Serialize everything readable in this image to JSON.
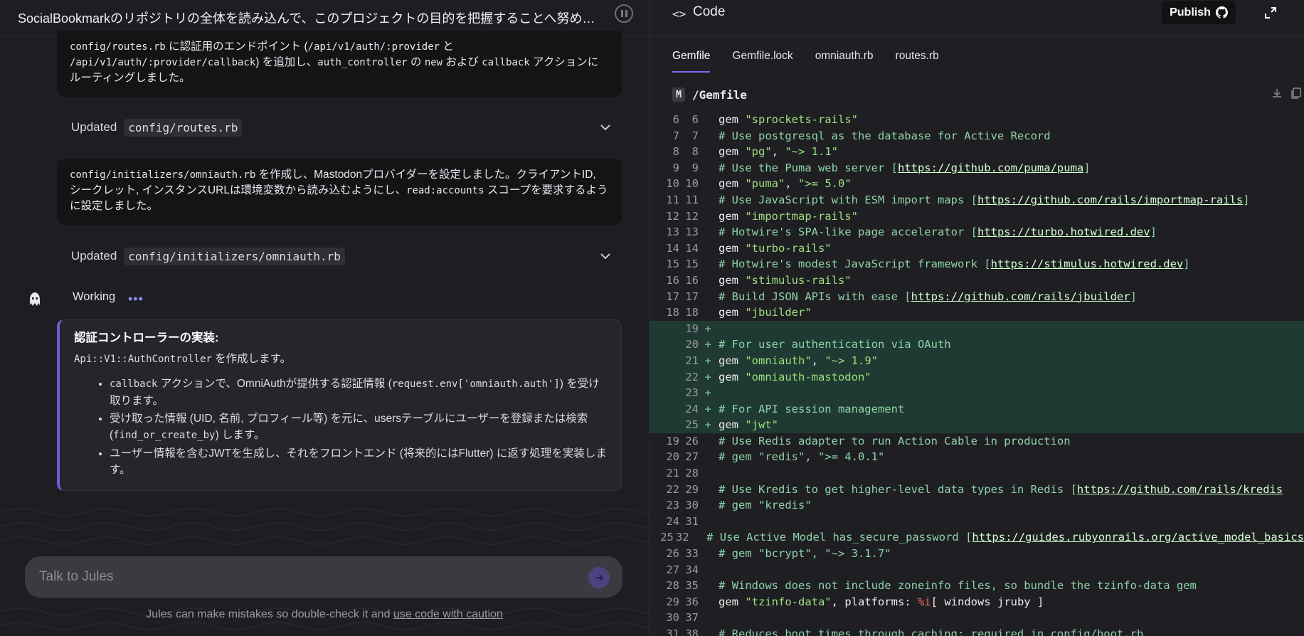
{
  "task": {
    "title": "SocialBookmarkのリポジトリの全体を読み込んで、このプロジェクトの目的を把握することへ努めて下..."
  },
  "messages": {
    "card1": {
      "text_a": "config/routes.rb",
      "text_b": " に認証用のエンドポイント (",
      "text_c": "/api/v1/auth/:provider",
      "text_d": " と",
      "text_e": "/api/v1/auth/:provider/callback",
      "text_f": ") を追加し、",
      "text_g": "auth_controller",
      "text_h": " の ",
      "text_i": "new",
      "text_j": " および ",
      "text_k": "callback",
      "text_l": " アクションにルーティングしました。"
    },
    "updated1": {
      "label": "Updated",
      "file": "config/routes.rb"
    },
    "card2": {
      "text_a": "config/initializers/omniauth.rb",
      "text_b": " を作成し、Mastodonプロバイダーを設定しました。クライアントID, シークレット, インスタンスURLは環境変数から読み込むようにし、",
      "text_c": "read:accounts",
      "text_d": " スコープを要求するように設定しました。"
    },
    "updated2": {
      "label": "Updated",
      "file": "config/initializers/omniauth.rb"
    },
    "working": {
      "label": "Working",
      "dots": "•••"
    },
    "plan": {
      "title": "認証コントローラーの実装:",
      "sub_code": "Api::V1::AuthController",
      "sub_text": " を作成します。",
      "items": [
        {
          "a": "callback",
          "b": " アクションで、OmniAuthが提供する認証情報 (",
          "c": "request.env['omniauth.auth']",
          "d": ") を受け取ります。"
        },
        {
          "a": "",
          "b": "受け取った情報 (UID, 名前, プロフィール等) を元に、usersテーブルにユーザーを登録または検索 (",
          "c": "find_or_create_by",
          "d": ") します。"
        },
        {
          "a": "",
          "b": "ユーザー情報を含むJWTを生成し、それをフロントエンド (将来的にはFlutter) に返す処理を実装します。",
          "c": "",
          "d": ""
        }
      ]
    }
  },
  "chat": {
    "placeholder": "Talk to Jules",
    "disclaimer_text": "Jules can make mistakes so double-check it and ",
    "disclaimer_link": "use code with caution"
  },
  "code_panel": {
    "icon": "<>",
    "title": "Code",
    "publish_label": "Publish",
    "tabs": [
      "Gemfile",
      "Gemfile.lock",
      "omniauth.rb",
      "routes.rb"
    ],
    "active_tab": "Gemfile",
    "file_badge": "M",
    "file_path": "/Gemfile",
    "lines": [
      {
        "o": "6",
        "n": "6",
        "m": "",
        "added": false,
        "segs": [
          [
            "kw",
            "gem "
          ],
          [
            "string",
            "\"sprockets-rails\""
          ]
        ]
      },
      {
        "o": "7",
        "n": "7",
        "m": "",
        "added": false,
        "segs": [
          [
            "comment",
            "# Use postgresql as the database for Active Record"
          ]
        ]
      },
      {
        "o": "8",
        "n": "8",
        "m": "",
        "added": false,
        "segs": [
          [
            "kw",
            "gem "
          ],
          [
            "string",
            "\"pg\""
          ],
          [
            "kw",
            ", "
          ],
          [
            "string",
            "\"~> 1.1\""
          ]
        ]
      },
      {
        "o": "9",
        "n": "9",
        "m": "",
        "added": false,
        "segs": [
          [
            "comment",
            "# Use the Puma web server ["
          ],
          [
            "url",
            "https://github.com/puma/puma"
          ],
          [
            "comment",
            "]"
          ]
        ]
      },
      {
        "o": "10",
        "n": "10",
        "m": "",
        "added": false,
        "segs": [
          [
            "kw",
            "gem "
          ],
          [
            "string",
            "\"puma\""
          ],
          [
            "kw",
            ", "
          ],
          [
            "string",
            "\">= 5.0\""
          ]
        ]
      },
      {
        "o": "11",
        "n": "11",
        "m": "",
        "added": false,
        "segs": [
          [
            "comment",
            "# Use JavaScript with ESM import maps ["
          ],
          [
            "url",
            "https://github.com/rails/importmap-rails"
          ],
          [
            "comment",
            "]"
          ]
        ]
      },
      {
        "o": "12",
        "n": "12",
        "m": "",
        "added": false,
        "segs": [
          [
            "kw",
            "gem "
          ],
          [
            "string",
            "\"importmap-rails\""
          ]
        ]
      },
      {
        "o": "13",
        "n": "13",
        "m": "",
        "added": false,
        "segs": [
          [
            "comment",
            "# Hotwire's SPA-like page accelerator ["
          ],
          [
            "url",
            "https://turbo.hotwired.dev"
          ],
          [
            "comment",
            "]"
          ]
        ]
      },
      {
        "o": "14",
        "n": "14",
        "m": "",
        "added": false,
        "segs": [
          [
            "kw",
            "gem "
          ],
          [
            "string",
            "\"turbo-rails\""
          ]
        ]
      },
      {
        "o": "15",
        "n": "15",
        "m": "",
        "added": false,
        "segs": [
          [
            "comment",
            "# Hotwire's modest JavaScript framework ["
          ],
          [
            "url",
            "https://stimulus.hotwired.dev"
          ],
          [
            "comment",
            "]"
          ]
        ]
      },
      {
        "o": "16",
        "n": "16",
        "m": "",
        "added": false,
        "segs": [
          [
            "kw",
            "gem "
          ],
          [
            "string",
            "\"stimulus-rails\""
          ]
        ]
      },
      {
        "o": "17",
        "n": "17",
        "m": "",
        "added": false,
        "segs": [
          [
            "comment",
            "# Build JSON APIs with ease ["
          ],
          [
            "url",
            "https://github.com/rails/jbuilder"
          ],
          [
            "comment",
            "]"
          ]
        ]
      },
      {
        "o": "18",
        "n": "18",
        "m": "",
        "added": false,
        "segs": [
          [
            "kw",
            "gem "
          ],
          [
            "string",
            "\"jbuilder\""
          ]
        ]
      },
      {
        "o": "",
        "n": "19",
        "m": "+",
        "added": true,
        "segs": []
      },
      {
        "o": "",
        "n": "20",
        "m": "+",
        "added": true,
        "segs": [
          [
            "comment",
            "# For user authentication via OAuth"
          ]
        ]
      },
      {
        "o": "",
        "n": "21",
        "m": "+",
        "added": true,
        "segs": [
          [
            "kw",
            "gem "
          ],
          [
            "string",
            "\"omniauth\""
          ],
          [
            "kw",
            ", "
          ],
          [
            "string",
            "\"~> 1.9\""
          ]
        ]
      },
      {
        "o": "",
        "n": "22",
        "m": "+",
        "added": true,
        "segs": [
          [
            "kw",
            "gem "
          ],
          [
            "string",
            "\"omniauth-mastodon\""
          ]
        ]
      },
      {
        "o": "",
        "n": "23",
        "m": "+",
        "added": true,
        "segs": []
      },
      {
        "o": "",
        "n": "24",
        "m": "+",
        "added": true,
        "segs": [
          [
            "comment",
            "# For API session management"
          ]
        ]
      },
      {
        "o": "",
        "n": "25",
        "m": "+",
        "added": true,
        "segs": [
          [
            "kw",
            "gem "
          ],
          [
            "string",
            "\"jwt\""
          ]
        ]
      },
      {
        "o": "19",
        "n": "26",
        "m": "",
        "added": false,
        "segs": [
          [
            "comment",
            "# Use Redis adapter to run Action Cable in production"
          ]
        ]
      },
      {
        "o": "20",
        "n": "27",
        "m": "",
        "added": false,
        "segs": [
          [
            "comment",
            "# gem \"redis\", \">= 4.0.1\""
          ]
        ]
      },
      {
        "o": "21",
        "n": "28",
        "m": "",
        "added": false,
        "segs": []
      },
      {
        "o": "22",
        "n": "29",
        "m": "",
        "added": false,
        "segs": [
          [
            "comment",
            "# Use Kredis to get higher-level data types in Redis ["
          ],
          [
            "url",
            "https://github.com/rails/kredis"
          ]
        ]
      },
      {
        "o": "23",
        "n": "30",
        "m": "",
        "added": false,
        "segs": [
          [
            "comment",
            "# gem \"kredis\""
          ]
        ]
      },
      {
        "o": "24",
        "n": "31",
        "m": "",
        "added": false,
        "segs": []
      },
      {
        "o": "25",
        "n": "32",
        "m": "",
        "added": false,
        "segs": [
          [
            "comment",
            "# Use Active Model has_secure_password ["
          ],
          [
            "url",
            "https://guides.rubyonrails.org/active_model_basics"
          ]
        ]
      },
      {
        "o": "26",
        "n": "33",
        "m": "",
        "added": false,
        "segs": [
          [
            "comment",
            "# gem \"bcrypt\", \"~> 3.1.7\""
          ]
        ]
      },
      {
        "o": "27",
        "n": "34",
        "m": "",
        "added": false,
        "segs": []
      },
      {
        "o": "28",
        "n": "35",
        "m": "",
        "added": false,
        "segs": [
          [
            "comment",
            "# Windows does not include zoneinfo files, so bundle the tzinfo-data gem"
          ]
        ]
      },
      {
        "o": "29",
        "n": "36",
        "m": "",
        "added": false,
        "segs": [
          [
            "kw",
            "gem "
          ],
          [
            "string",
            "\"tzinfo-data\""
          ],
          [
            "kw",
            ", platforms: "
          ],
          [
            "sym",
            "%i"
          ],
          [
            "kw",
            "[ windows jruby ]"
          ]
        ]
      },
      {
        "o": "30",
        "n": "37",
        "m": "",
        "added": false,
        "segs": []
      },
      {
        "o": "31",
        "n": "38",
        "m": "",
        "added": false,
        "segs": [
          [
            "comment",
            "# Reduces boot times through caching; required in config/boot.rb"
          ]
        ]
      }
    ]
  },
  "colors": {
    "accent": "#6d5fd6",
    "added_line_bg": "#1f3a32"
  }
}
